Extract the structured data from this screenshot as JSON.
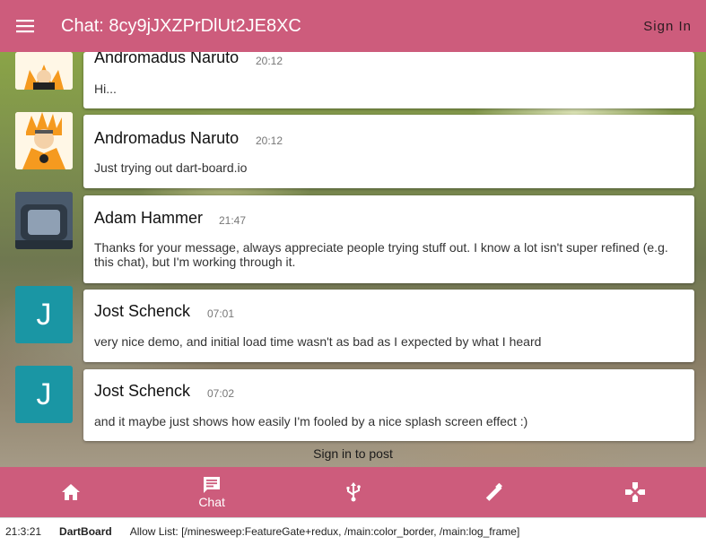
{
  "appbar": {
    "title": "Chat: 8cy9jJXZPrDlUt2JE8XC",
    "sign_in": "Sign In",
    "menu_icon": "menu-icon"
  },
  "messages": [
    {
      "author": "Andromadus Naruto",
      "time": "20:12",
      "text": "Hi...",
      "avatar": "naruto-avatar"
    },
    {
      "author": "Andromadus Naruto",
      "time": "20:12",
      "text": "Just trying out dart-board.io",
      "avatar": "naruto-avatar"
    },
    {
      "author": "Adam Hammer",
      "time": "21:47",
      "text": "Thanks for your message, always appreciate people trying stuff out. I know a lot isn't super refined (e.g. this chat), but I'm working through it.",
      "avatar": "adam-avatar"
    },
    {
      "author": "Jost Schenck",
      "time": "07:01",
      "text": "very nice demo, and initial load time wasn't as bad as I expected by what I heard",
      "avatar_letter": "J"
    },
    {
      "author": "Jost Schenck",
      "time": "07:02",
      "text": "and it maybe just shows how easily I'm fooled by a nice splash screen effect :)",
      "avatar_letter": "J"
    }
  ],
  "sign_in_to_post": "Sign in to post",
  "bottom_nav": {
    "items": [
      {
        "icon": "home-icon",
        "label": ""
      },
      {
        "icon": "chat-icon",
        "label": "Chat",
        "active": true
      },
      {
        "icon": "usb-icon",
        "label": ""
      },
      {
        "icon": "wand-icon",
        "label": ""
      },
      {
        "icon": "gamepad-icon",
        "label": ""
      }
    ]
  },
  "status_bar": {
    "time": "21:3:21",
    "app": "DartBoard",
    "allow_list": "Allow List: [/minesweep:FeatureGate+redux, /main:color_border, /main:log_frame]"
  },
  "colors": {
    "primary": "#cd5c7c",
    "avatar_teal": "#1a96a4"
  }
}
